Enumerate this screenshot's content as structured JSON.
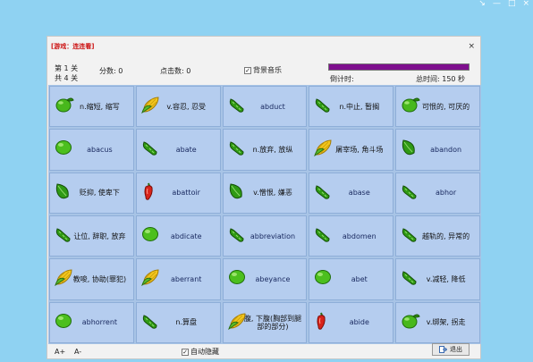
{
  "host": {
    "controls": [
      "↘",
      "—",
      "□",
      "×"
    ]
  },
  "window": {
    "title": "[游戏：连连看]",
    "close": "×"
  },
  "info": {
    "level_current": "第 1 关",
    "level_total": "共 4 关",
    "score": "分数:  0",
    "clicks": "点击数:  0",
    "music_check": "✓",
    "music": "背景音乐",
    "progress_fraction": 1.0,
    "countdown": "倒计时:",
    "total": "总时间:  150 秒"
  },
  "board": {
    "cells": [
      {
        "icon": "lime-leaf",
        "text": "n.缩短, 缩写"
      },
      {
        "icon": "corn",
        "text": "v.容忍, 忍受"
      },
      {
        "icon": "cucumber",
        "text": "abduct"
      },
      {
        "icon": "cucumber",
        "text": "n.中止, 暂搁"
      },
      {
        "icon": "lime-leaf",
        "text": "可恨的, 可厌的"
      },
      {
        "icon": "lime",
        "text": "abacus"
      },
      {
        "icon": "cucumber",
        "text": "abate"
      },
      {
        "icon": "cucumber",
        "text": "n.放弃, 放纵"
      },
      {
        "icon": "corn",
        "text": "屠宰场, 角斗场"
      },
      {
        "icon": "leaf",
        "text": "abandon"
      },
      {
        "icon": "leaf",
        "text": "贬抑, 使卑下"
      },
      {
        "icon": "pepper",
        "text": "abattoir"
      },
      {
        "icon": "leaf",
        "text": "v.憎恨, 嫌恶"
      },
      {
        "icon": "cucumber",
        "text": "abase"
      },
      {
        "icon": "cucumber",
        "text": "abhor"
      },
      {
        "icon": "cucumber",
        "text": "让位, 辞职, 放弃"
      },
      {
        "icon": "lime",
        "text": "abdicate"
      },
      {
        "icon": "cucumber",
        "text": "abbreviation"
      },
      {
        "icon": "cucumber",
        "text": "abdomen"
      },
      {
        "icon": "cucumber",
        "text": "越轨的, 异常的"
      },
      {
        "icon": "corn",
        "text": "教唆, 协助(罪犯)"
      },
      {
        "icon": "corn",
        "text": "aberrant"
      },
      {
        "icon": "lime",
        "text": "abeyance"
      },
      {
        "icon": "lime",
        "text": "abet"
      },
      {
        "icon": "cucumber",
        "text": "v.减轻, 降低"
      },
      {
        "icon": "lime",
        "text": "abhorrent"
      },
      {
        "icon": "cucumber",
        "text": "n.算盘"
      },
      {
        "icon": "corn",
        "text": "腹, 下腹(胸部到腿部的部分)"
      },
      {
        "icon": "pepper",
        "text": "abide"
      },
      {
        "icon": "lime-leaf",
        "text": "v.绑架, 拐走"
      }
    ],
    "colors": {
      "cell": "#b5cdef",
      "grid": "#a8c4e6",
      "progress": "#7f0f8e"
    }
  },
  "bottom": {
    "font_up": "A+",
    "font_down": "A-",
    "auto_hide_check": "✓",
    "auto_hide": "自动隐藏",
    "exit": "退出"
  }
}
